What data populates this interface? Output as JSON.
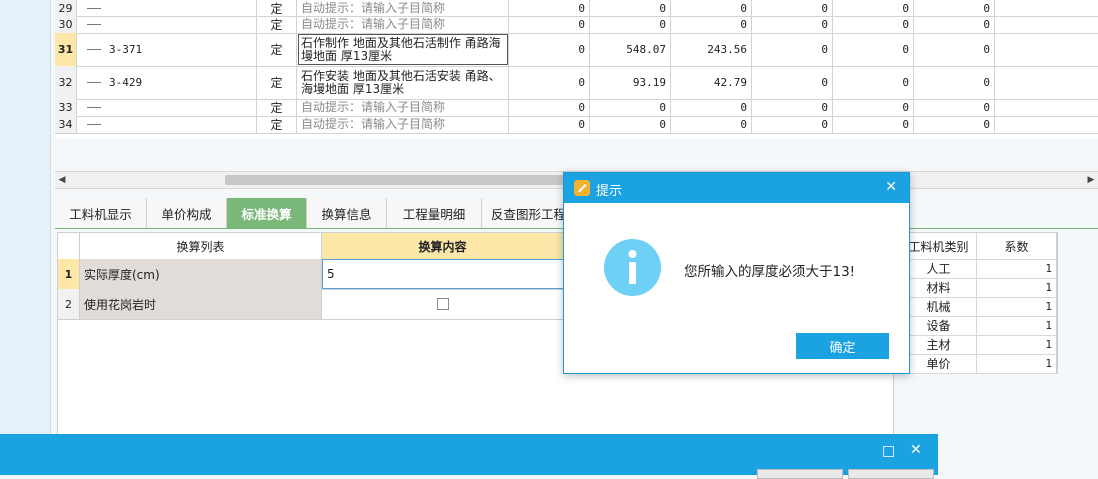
{
  "grid": {
    "rows": [
      {
        "num": "29",
        "code": "",
        "unit": "定",
        "name": "自动提示：请输入子目简称",
        "hint": true,
        "v1": "0",
        "v2": "0",
        "v3": "0",
        "v4": "0",
        "v5": "0",
        "v6": "0"
      },
      {
        "num": "30",
        "code": "",
        "unit": "定",
        "name": "自动提示：请输入子目简称",
        "hint": true,
        "v1": "0",
        "v2": "0",
        "v3": "0",
        "v4": "0",
        "v5": "0",
        "v6": "0"
      },
      {
        "num": "31",
        "code": "3-371",
        "unit": "定",
        "name": "石作制作 地面及其他石活制作 甬路海墁地面 厚13厘米",
        "hint": false,
        "v1": "0",
        "v2": "548.07",
        "v3": "243.56",
        "v4": "0",
        "v5": "0",
        "v6": "0",
        "selected": true
      },
      {
        "num": "32",
        "code": "3-429",
        "unit": "定",
        "name": "石作安装 地面及其他石活安装 甬路、海墁地面 厚13厘米",
        "hint": false,
        "v1": "0",
        "v2": "93.19",
        "v3": "42.79",
        "v4": "0",
        "v5": "0",
        "v6": "0"
      },
      {
        "num": "33",
        "code": "",
        "unit": "定",
        "name": "自动提示：请输入子目简称",
        "hint": true,
        "v1": "0",
        "v2": "0",
        "v3": "0",
        "v4": "0",
        "v5": "0",
        "v6": "0"
      },
      {
        "num": "34",
        "code": "",
        "unit": "定",
        "name": "自动提示：请输入子目简称",
        "hint": true,
        "v1": "0",
        "v2": "0",
        "v3": "0",
        "v4": "0",
        "v5": "0",
        "v6": "0"
      }
    ]
  },
  "tabs": [
    {
      "label": "工料机显示"
    },
    {
      "label": "单价构成"
    },
    {
      "label": "标准换算",
      "active": true
    },
    {
      "label": "换算信息"
    },
    {
      "label": "工程量明细"
    },
    {
      "label": "反查图形工程"
    }
  ],
  "conversion": {
    "header_list": "换算列表",
    "header_content": "换算内容",
    "rows": [
      {
        "num": "1",
        "label": "实际厚度(cm)",
        "value": "5"
      },
      {
        "num": "2",
        "label": "使用花岗岩时",
        "value": ""
      }
    ]
  },
  "factor_table": {
    "header_type": "工料机类别",
    "header_factor": "系数",
    "rows": [
      {
        "type": "人工",
        "factor": "1"
      },
      {
        "type": "材料",
        "factor": "1"
      },
      {
        "type": "机械",
        "factor": "1"
      },
      {
        "type": "设备",
        "factor": "1"
      },
      {
        "type": "主材",
        "factor": "1"
      },
      {
        "type": "单价",
        "factor": "1"
      }
    ]
  },
  "dialog": {
    "title": "提示",
    "message": "您所输入的厚度必须大于13!",
    "ok_label": "确定",
    "close_glyph": "✕"
  },
  "bottombar": {
    "maximize_glyph": "□",
    "close_glyph": "✕"
  },
  "scroll": {
    "left_glyph": "◀",
    "right_glyph": "▶"
  },
  "colors": {
    "accent": "#1aa3e0",
    "tab_active": "#7ab87a",
    "selected_row": "#fce6a8",
    "header_highlight": "#fce6a8"
  }
}
